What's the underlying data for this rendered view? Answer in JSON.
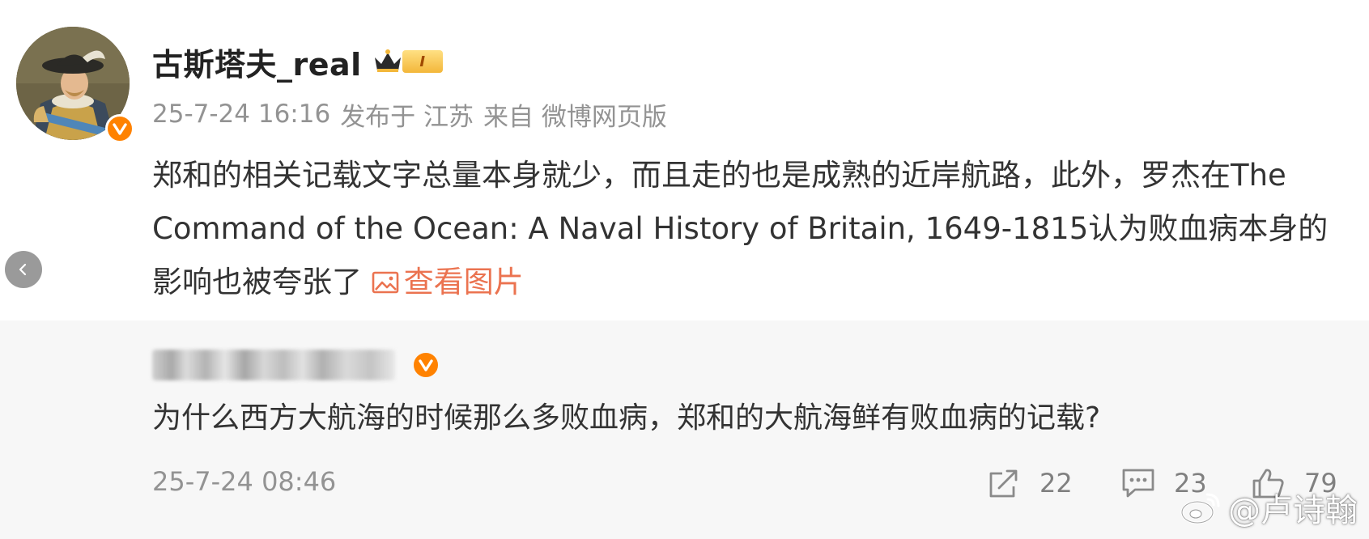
{
  "post": {
    "username": "古斯塔夫_real",
    "vip_level": "I",
    "time": "25-7-24 16:16",
    "location": "发布于 江苏",
    "source": "来自 微博网页版",
    "text": "郑和的相关记载文字总量本身就少，而且走的也是成熟的近岸航路，此外，罗杰在The Command of the Ocean: A Naval History of Britain, 1649-1815认为败血病本身的影响也被夸张了",
    "view_pics_label": "查看图片"
  },
  "quoted": {
    "text": "为什么西方大航海的时候那么多败血病，郑和的大航海鲜有败血病的记载?",
    "time": "25-7-24 08:46",
    "share_count": "22",
    "comment_count": "23",
    "like_count": "79"
  },
  "watermark": {
    "text": "@卢诗翰"
  },
  "colors": {
    "accent_orange": "#ff8200",
    "link_orange": "#eb7350",
    "meta_gray": "#939393",
    "quoted_bg": "#f7f7f7"
  },
  "icons": [
    "verified-badge-icon",
    "crown-icon",
    "image-icon",
    "chevron-left-icon",
    "share-icon",
    "comment-icon",
    "like-icon",
    "weibo-logo-icon"
  ]
}
